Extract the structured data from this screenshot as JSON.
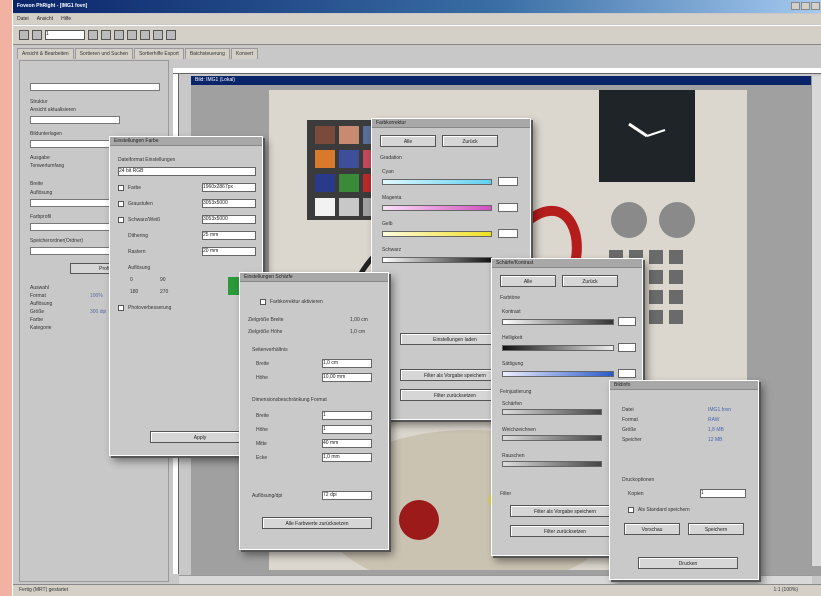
{
  "window": {
    "title": "Foveon PhRight - [IMG1 fovn]"
  },
  "menu": {
    "items": [
      "Datei",
      "Ansicht",
      "Hilfe"
    ]
  },
  "toolbar": {
    "zoom_value": "1"
  },
  "tabs": [
    "Ansicht & Bearbeiten",
    "Sortieren und Suchen",
    "Sortierhilfe Export",
    "Batchsteuerung",
    "Konvert"
  ],
  "sidebar": {
    "rows": [
      "Struktur",
      "Ansicht aktualisieren",
      "Bildunterlagen",
      "Ausgabe",
      "Tonwertumfang",
      "Breite",
      "Auflösung",
      "Farbprofil",
      "Speicherordner(Ordner)",
      "Auswahl",
      "Format",
      "Auflösung",
      "Größe",
      "Farbe",
      "Kategorie"
    ],
    "values": [
      "100%",
      "300 dpi"
    ],
    "button": "Profil erstellen"
  },
  "image_window": {
    "title": "Bild: IMG1 (Lokal)"
  },
  "dialog_1": {
    "title": "Einstellungen Farbe",
    "group": "Dateiformat Einstellungen",
    "select_value": "24 bit RGB",
    "checks": [
      "Farbe",
      "Graustufen",
      "Schwarz/Weiß",
      "Dithering",
      "Rastern"
    ],
    "values": [
      "1960x2867px",
      "3053x5000",
      "3053x5000",
      "25 mm",
      "20 mm"
    ],
    "sub": "Auflösung",
    "radios": [
      "0",
      "90",
      "180",
      "270"
    ],
    "extra": "Photoverbesserung",
    "button": "Apply"
  },
  "dialog_2": {
    "title": "Farbkorrektur",
    "tabs": [
      "Alle",
      "Zurück"
    ],
    "group": "Gradation",
    "channels": [
      "Cyan",
      "Magenta",
      "Gelb",
      "Schwarz"
    ],
    "group2": "Filter",
    "buttons": [
      "Einstellungen laden",
      "Filter als Vorgabe speichern",
      "Filter zurücksetzen"
    ]
  },
  "dialog_3": {
    "title": "Einstellungen Schärfe",
    "check": "Farbkorrektur aktivieren",
    "rows": [
      [
        "Zielgröße Breite",
        "1,00 cm"
      ],
      [
        "Zielgröße Höhe",
        "1,0 cm"
      ]
    ],
    "group": "Seitenverhältnis",
    "fields": [
      [
        "Breite",
        "1,0 cm"
      ],
      [
        "Höhe",
        "10,00 mm"
      ]
    ],
    "group2": "Dimensionsbeschränkung Format",
    "fields2": [
      [
        "Breite",
        "1"
      ],
      [
        "Höhe",
        "1"
      ],
      [
        "Mitte",
        "40 mm"
      ],
      [
        "Ecke",
        "1,0 mm"
      ]
    ],
    "footer_label": "Auflösung/dpi",
    "footer_value": "72 dpi",
    "button": "Alle Farbwerte zurücksetzen"
  },
  "dialog_4": {
    "title": "Schärfe/Kontrast",
    "tabs": [
      "Alle",
      "Zurück"
    ],
    "group": "Farbtöne",
    "channels": [
      "Kontrast",
      "Helligkeit",
      "Sättigung"
    ],
    "group2": "Feinjustierung",
    "channels2": [
      "Schärfen",
      "Weichzeichnen",
      "Rauschen"
    ],
    "group3": "Filter",
    "buttons": [
      "Filter als Vorgabe speichern",
      "Filter zurücksetzen"
    ]
  },
  "dialog_5": {
    "title": "Bildinfo",
    "rows": [
      [
        "Datei",
        "IMG1.fovn"
      ],
      [
        "Format",
        "RAW"
      ],
      [
        "Größe",
        "1,8 MB"
      ],
      [
        "Speicher",
        "12 MB"
      ]
    ],
    "group": "Druckoptionen",
    "field_label": "Kopien",
    "field_value": "1",
    "check": "Als Standard speichern",
    "buttons": [
      "Vorschau",
      "Speichern",
      "Drucken"
    ]
  },
  "status": {
    "left": "Fertig (MRT) gestartet",
    "right": "1:1 (100%)"
  },
  "colors": {
    "accent": "#0a246a",
    "background": "#f2b2a2",
    "panel": "#c8c8c8"
  }
}
